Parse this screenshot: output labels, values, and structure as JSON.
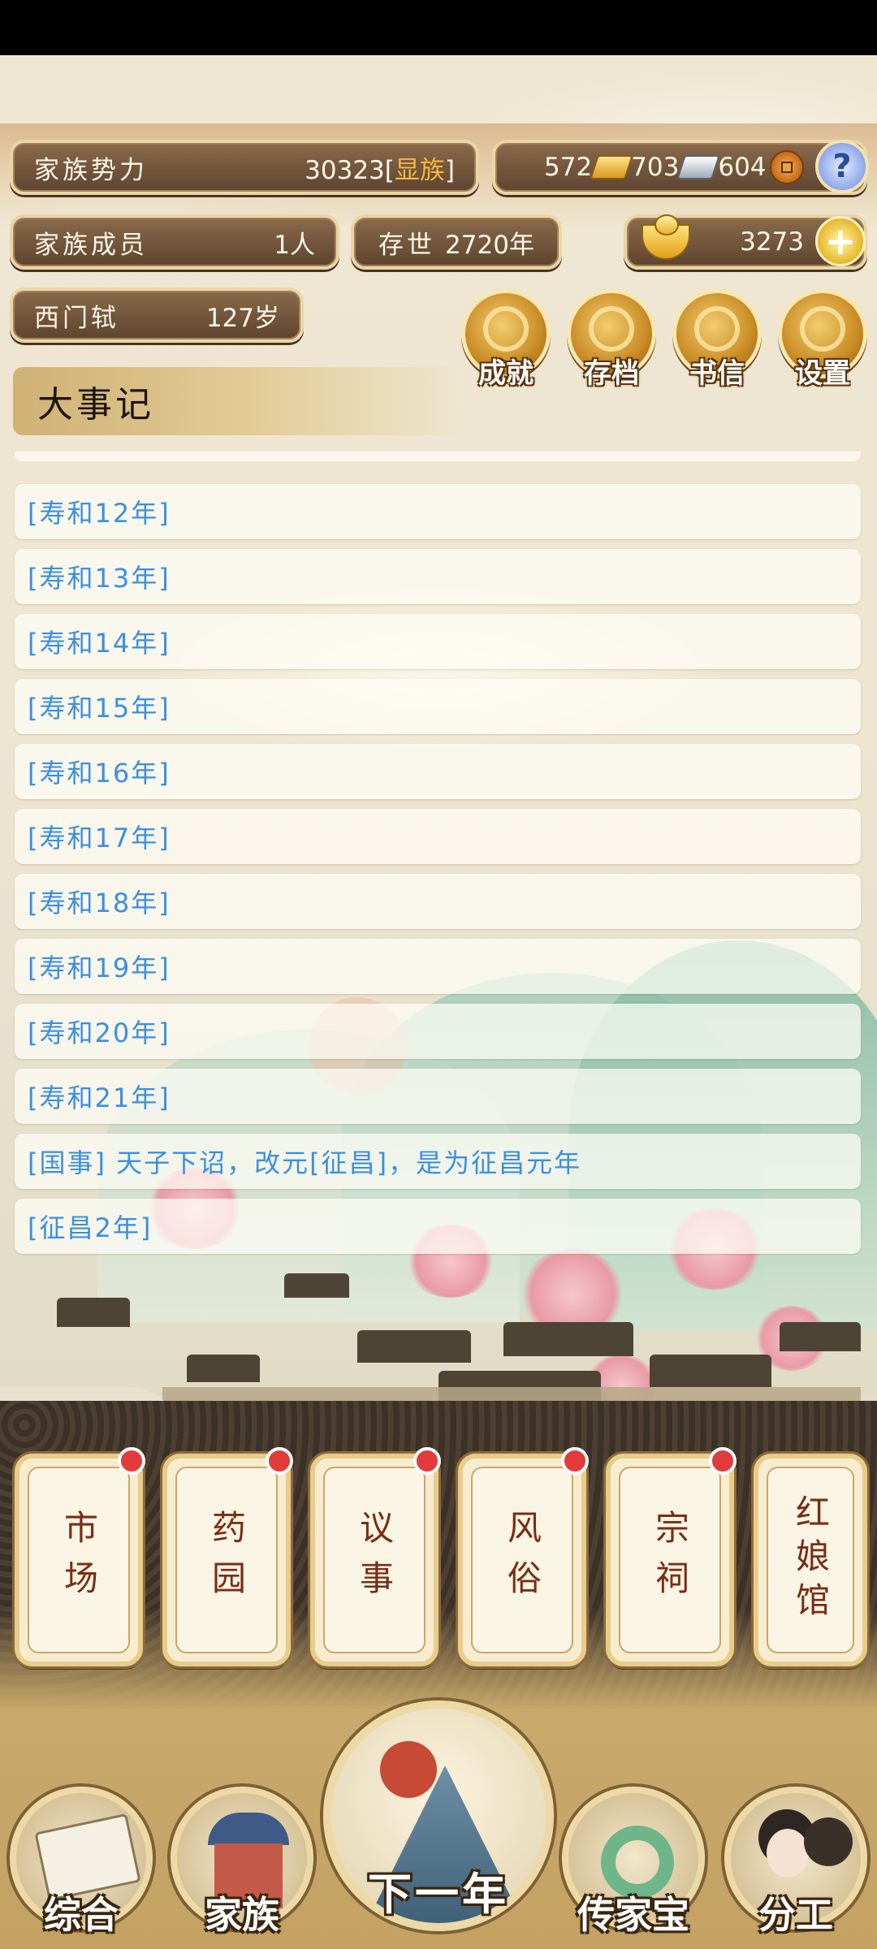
{
  "stats": {
    "clan_power_label": "家族势力",
    "clan_power_value": "30323",
    "clan_rank_open": "[",
    "clan_rank": "显族",
    "clan_rank_close": "]",
    "members_label": "家族成员",
    "members_value": "1人",
    "survival_label": "存世",
    "survival_value": "2720年",
    "leader_name": "西门轼",
    "leader_age": "127岁"
  },
  "currency": {
    "gold_bars": "572",
    "silver_bars": "703",
    "coins": "604",
    "yuanbao": "3273",
    "help_icon": "?",
    "add_icon": "+"
  },
  "menu": [
    {
      "label": "成就",
      "icon": "achievement-icon"
    },
    {
      "label": "存档",
      "icon": "save-icon"
    },
    {
      "label": "书信",
      "icon": "letter-icon"
    },
    {
      "label": "设置",
      "icon": "settings-icon"
    }
  ],
  "chronicle": {
    "title": "大事记",
    "entries": [
      "[寿和12年]",
      "[寿和13年]",
      "[寿和14年]",
      "[寿和15年]",
      "[寿和16年]",
      "[寿和17年]",
      "[寿和18年]",
      "[寿和19年]",
      "[寿和20年]",
      "[寿和21年]",
      "[国事] 天子下诏，改元[征昌]，是为征昌元年",
      "[征昌2年]"
    ]
  },
  "cards": [
    {
      "label": "市场",
      "dot": true
    },
    {
      "label": "药园",
      "dot": true
    },
    {
      "label": "议事",
      "dot": true
    },
    {
      "label": "风俗",
      "dot": true
    },
    {
      "label": "宗祠",
      "dot": true
    },
    {
      "label": "红娘馆",
      "dot": false
    }
  ],
  "nav": {
    "overview": "综合",
    "family": "家族",
    "next_year": "下一年",
    "heirloom": "传家宝",
    "assign": "分工"
  }
}
